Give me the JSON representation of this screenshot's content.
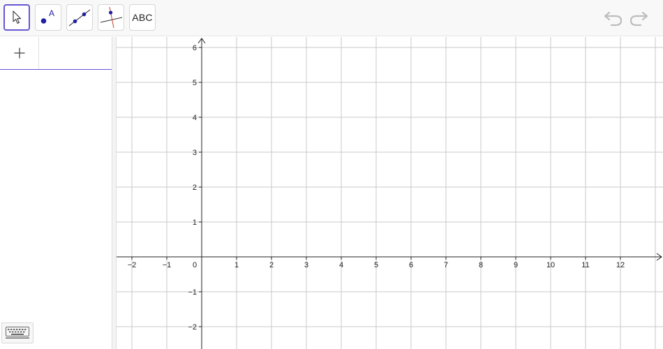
{
  "toolbar": {
    "tools": [
      {
        "name": "move-tool",
        "label": ""
      },
      {
        "name": "point-tool",
        "label": "A"
      },
      {
        "name": "line-tool",
        "label": ""
      },
      {
        "name": "perpendicular-tool",
        "label": ""
      },
      {
        "name": "text-tool",
        "label": "ABC"
      }
    ],
    "selected_tool": "move-tool",
    "accent_color": "#6557d2",
    "point_color": "#1f1fa8",
    "undo_icon": "undo-icon",
    "redo_icon": "redo-icon"
  },
  "algebra": {
    "add_label": "+",
    "keyboard_icon": "keyboard-icon"
  },
  "graphics": {
    "x_ticks": [
      "−2",
      "−1",
      "0",
      "1",
      "2",
      "3",
      "4",
      "5",
      "6",
      "7",
      "8",
      "9",
      "10",
      "11",
      "12"
    ],
    "y_ticks": [
      "6",
      "5",
      "4",
      "3",
      "2",
      "1",
      "−1",
      "−2"
    ],
    "x_range": [
      -2.4,
      13.2
    ],
    "y_range": [
      -2.6,
      6.3
    ],
    "grid": true,
    "grid_color": "#c8c8c8",
    "axis_color": "#222222"
  }
}
